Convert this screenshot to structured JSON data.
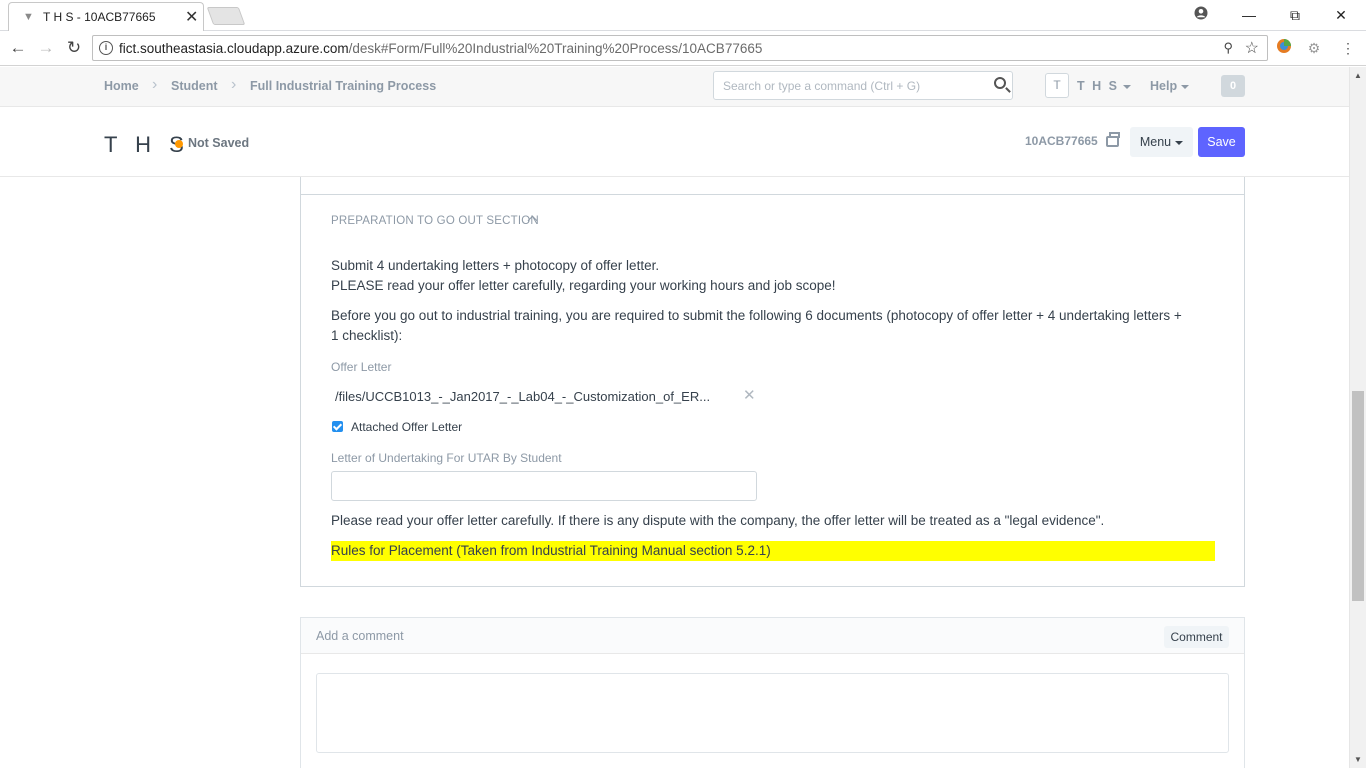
{
  "browser": {
    "tab_title": "T H S - 10ACB77665",
    "url_host": "fict.southeastasia.cloudapp.azure.com",
    "url_path": "/desk#Form/Full%20Industrial%20Training%20Process/10ACB77665"
  },
  "navbar": {
    "breadcrumbs": [
      "Home",
      "Student",
      "Full Industrial Training Process"
    ],
    "search_placeholder": "Search or type a command (Ctrl + G)",
    "avatar_letter": "T",
    "user_label": "T H S",
    "help_label": "Help",
    "notification_count": "0"
  },
  "page_head": {
    "title": "T H S",
    "status": "Not Saved",
    "doc_name": "10ACB77665",
    "menu_label": "Menu",
    "save_label": "Save",
    "status_color": "#ff9800",
    "primary_color": "#5e64ff"
  },
  "section": {
    "heading": "PREPARATION TO GO OUT SECTION",
    "para1_line1": "Submit 4 undertaking letters + photocopy of offer letter.",
    "para1_line2": "PLEASE read your offer letter carefully, regarding your working hours and job scope!",
    "para2": "Before you go out to industrial training, you are required to submit the following 6 documents (photocopy of offer letter + 4 undertaking letters + 1 checklist):",
    "offer_letter_label": "Offer Letter",
    "offer_letter_file": "/files/UCCB1013_-_Jan2017_-_Lab04_-_Customization_of_ER...",
    "attached_label": "Attached Offer Letter",
    "undertaking_label": "Letter of Undertaking For UTAR By Student",
    "undertaking_value": "",
    "dispute_note": "Please read your offer letter carefully. If there is any dispute with the company, the offer letter will be treated as a \"legal evidence\".",
    "rules_highlight": "Rules for Placement (Taken from Industrial Training Manual section 5.2.1)",
    "highlight_color": "#ffff00"
  },
  "comments": {
    "title": "Add a comment",
    "button_label": "Comment"
  }
}
